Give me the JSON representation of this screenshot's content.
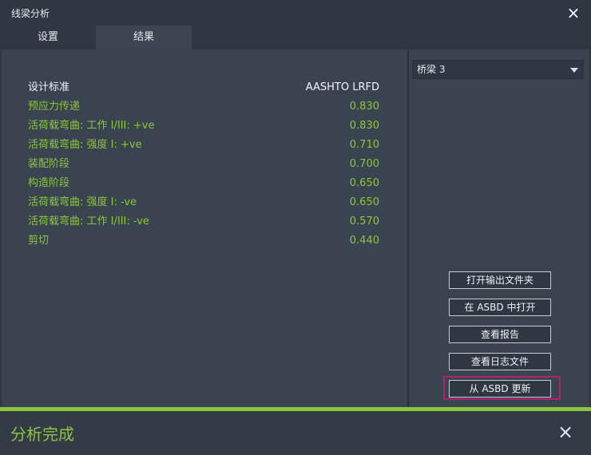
{
  "window": {
    "title": "线梁分析",
    "close_icon": "×"
  },
  "tabs": [
    {
      "label": "设置",
      "active": false
    },
    {
      "label": "结果",
      "active": true
    }
  ],
  "results": {
    "header": {
      "label": "设计标准",
      "value": "AASHTO LRFD"
    },
    "rows": [
      {
        "label": "预应力传递",
        "value": "0.830"
      },
      {
        "label": "活荷载弯曲: 工作 I/III: +ve",
        "value": "0.830"
      },
      {
        "label": "活荷载弯曲: 强度 I: +ve",
        "value": "0.710"
      },
      {
        "label": "装配阶段",
        "value": "0.700"
      },
      {
        "label": "构造阶段",
        "value": "0.650"
      },
      {
        "label": "活荷载弯曲: 强度 I: -ve",
        "value": "0.650"
      },
      {
        "label": "活荷载弯曲: 工作 I/III: -ve",
        "value": "0.570"
      },
      {
        "label": "剪切",
        "value": "0.440"
      }
    ]
  },
  "girder_select": {
    "value": "桥梁 3"
  },
  "actions": {
    "open_output_folder": "打开输出文件夹",
    "open_in_asbd": "在 ASBD 中打开",
    "view_report": "查看报告",
    "view_log": "查看日志文件",
    "update_from_asbd": "从 ASBD 更新"
  },
  "progress": {
    "fraction": 1.0
  },
  "status": {
    "text": "分析完成",
    "close_icon": "×"
  },
  "colors": {
    "accent_green": "#8cc63e",
    "highlight_border": "#b3206f",
    "background": "#3a4350"
  }
}
